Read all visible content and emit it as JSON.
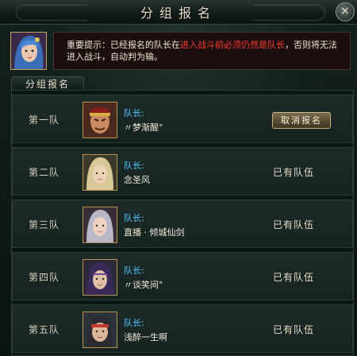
{
  "window": {
    "title": "分组报名",
    "close_glyph": "×"
  },
  "notice": {
    "prefix": "重要提示：已经报名的队长在",
    "highlight": "进入战斗前必须仍然是队长",
    "suffix": "，否则将无法进入战斗，自动判为输。"
  },
  "section_tab": "分组报名",
  "teams": [
    {
      "name": "第一队",
      "leader_label": "队长:",
      "leader": "〃梦渐醒°",
      "action": "取消报名"
    },
    {
      "name": "第二队",
      "leader_label": "队长:",
      "leader": "念圣风",
      "status": "已有队伍"
    },
    {
      "name": "第三队",
      "leader_label": "队长:",
      "leader": "直播 · 倾城仙剑",
      "status": "已有队伍"
    },
    {
      "name": "第四队",
      "leader_label": "队长:",
      "leader": "〃谈笑间°",
      "status": "已有队伍"
    },
    {
      "name": "第五队",
      "leader_label": "队长:",
      "leader": "浅醉一生啊",
      "status": "已有队伍"
    }
  ]
}
